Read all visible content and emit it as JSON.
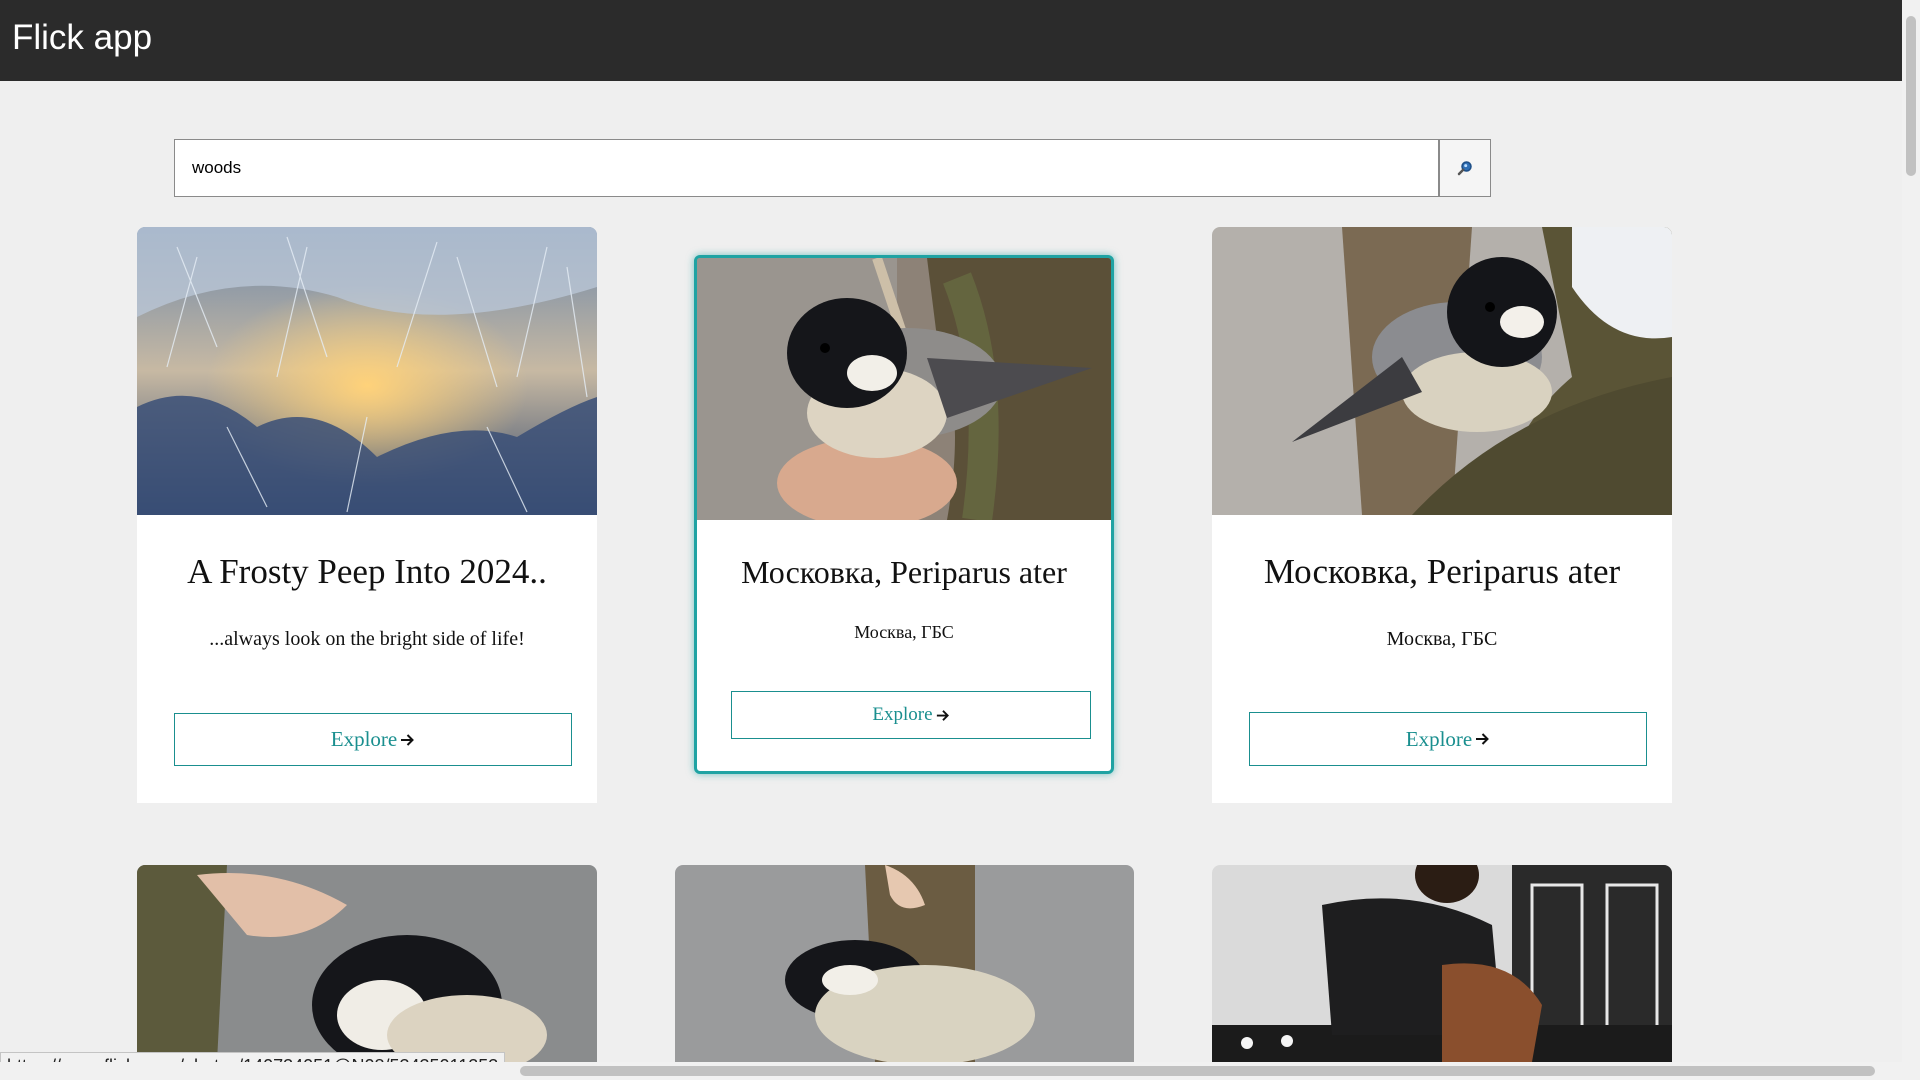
{
  "app": {
    "title": "Flick app"
  },
  "search": {
    "value": "woods",
    "button_icon": "search-icon"
  },
  "cards": [
    {
      "title": "A Frosty Peep Into 2024..",
      "description": "...always look on the bright side of life!",
      "button": "Explore",
      "image": "frost-crystals-sunset"
    },
    {
      "title": "Московка, Periparus ater",
      "description": "Москва, ГБС",
      "button": "Explore",
      "image": "coal-tit-on-feeder"
    },
    {
      "title": "Московка, Periparus ater",
      "description": "Москва, ГБС",
      "button": "Explore",
      "image": "coal-tit-on-branch"
    },
    {
      "image": "coal-tit-upside-down"
    },
    {
      "image": "coal-tit-on-suet"
    },
    {
      "image": "person-in-sweater-chair"
    }
  ],
  "status_bar": {
    "url": "https://www.flickr.com/photos/140734051@N08/53435011253"
  },
  "colors": {
    "navbar": "#2b2b2b",
    "accent": "#1a8f8f",
    "background": "#efefef"
  }
}
